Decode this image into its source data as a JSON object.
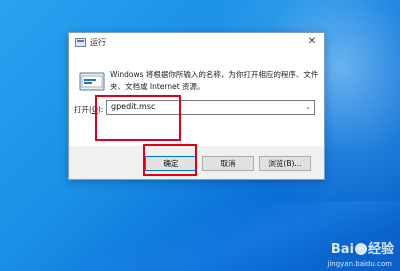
{
  "dialog": {
    "title": "运行",
    "close_glyph": "✕",
    "description": "Windows 将根据你所输入的名称，为你打开相应的程序、文件夹、文档或 Internet 资源。",
    "open_label_prefix": "打开(",
    "open_label_key": "O",
    "open_label_suffix": "):",
    "command_value": "gpedit.msc",
    "dropdown_glyph": "⌄",
    "buttons": {
      "ok": "确定",
      "cancel": "取消",
      "browse": "浏览(B)..."
    }
  },
  "watermark": {
    "brand_left": "Bai",
    "brand_right": "经验",
    "url": "jingyan.baidu.com"
  },
  "colors": {
    "highlight": "#e0001a",
    "desktop": "#1a8fe6",
    "accent": "#0078d7"
  },
  "icons": [
    "run-app-icon",
    "close-icon",
    "dropdown-arrow-icon",
    "baidu-paw-icon"
  ]
}
